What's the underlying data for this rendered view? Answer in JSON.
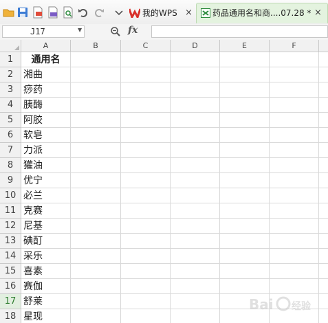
{
  "toolbar": {
    "icons": [
      "open-folder-icon",
      "save-icon",
      "export-pdf-icon",
      "print-icon",
      "print-preview-icon",
      "undo-icon",
      "redo-icon",
      "more-dropdown-icon"
    ],
    "tabs": [
      {
        "label": "我的WPS",
        "close": "×",
        "icon": "wps-logo-icon"
      },
      {
        "label": "药品通用名和商....07.28 *",
        "close": "×",
        "icon": "spreadsheet-icon",
        "active": true
      }
    ]
  },
  "formula_bar": {
    "name_box": "J17",
    "fx": "fx",
    "formula": ""
  },
  "sheet": {
    "column_headers": [
      "A",
      "B",
      "C",
      "D",
      "E",
      "F"
    ],
    "active_row": 17,
    "rows": [
      {
        "num": "1",
        "a": "通用名",
        "header": true
      },
      {
        "num": "2",
        "a": "湘曲"
      },
      {
        "num": "3",
        "a": "痧药"
      },
      {
        "num": "4",
        "a": "胰酶"
      },
      {
        "num": "5",
        "a": "阿胶"
      },
      {
        "num": "6",
        "a": "软皂"
      },
      {
        "num": "7",
        "a": "力派"
      },
      {
        "num": "8",
        "a": "獾油"
      },
      {
        "num": "9",
        "a": "优宁"
      },
      {
        "num": "10",
        "a": "必兰"
      },
      {
        "num": "11",
        "a": "克赛"
      },
      {
        "num": "12",
        "a": "尼基"
      },
      {
        "num": "13",
        "a": "碘酊"
      },
      {
        "num": "14",
        "a": "采乐"
      },
      {
        "num": "15",
        "a": "喜素"
      },
      {
        "num": "16",
        "a": "赛伽"
      },
      {
        "num": "17",
        "a": "舒莱"
      },
      {
        "num": "18",
        "a": "星现"
      }
    ]
  },
  "colors": {
    "active_tab_bg": "#e4f3df",
    "active_row_header": "#2f7d2f",
    "grid_line": "#d9d9d9"
  }
}
